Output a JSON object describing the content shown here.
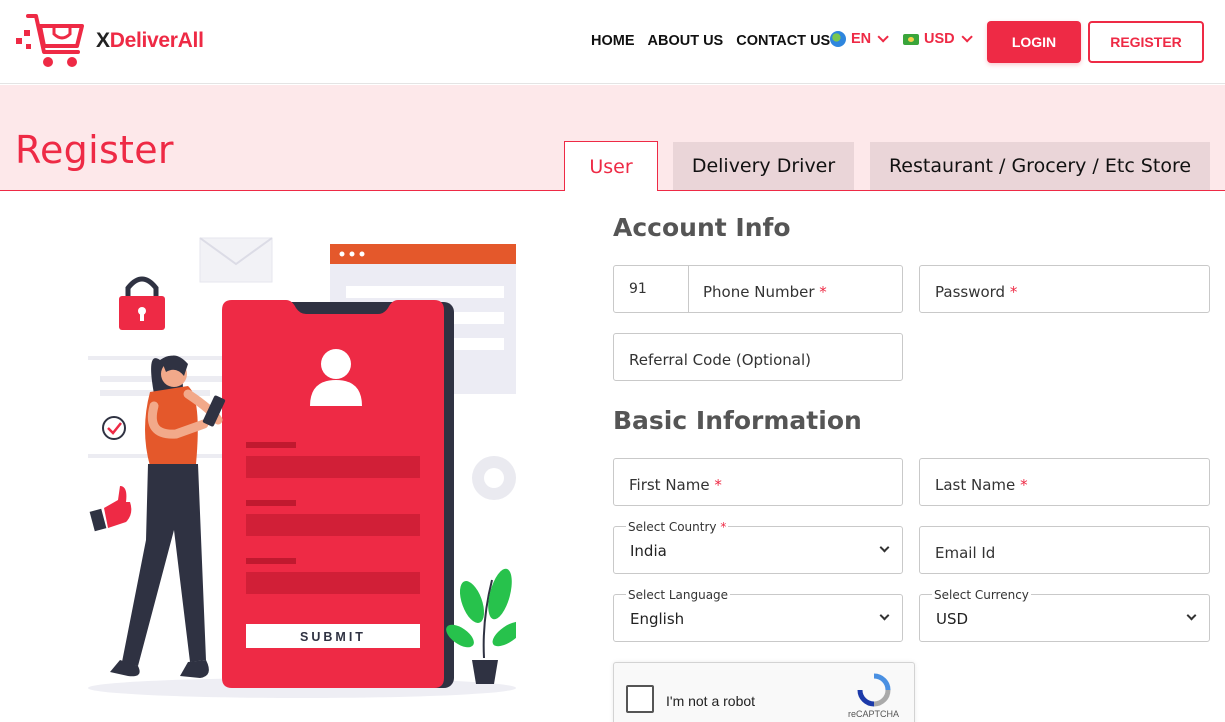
{
  "brand": {
    "name_prefix": "X",
    "name_rest": "DeliverAll",
    "accent": "#ee2a45"
  },
  "nav": {
    "items": [
      {
        "label": "HOME"
      },
      {
        "label": "ABOUT US"
      },
      {
        "label": "CONTACT US"
      }
    ],
    "language": {
      "icon": "globe-icon",
      "label": "EN"
    },
    "currency": {
      "icon": "flag-icon",
      "label": "USD"
    },
    "login_label": "LOGIN",
    "register_label": "REGISTER"
  },
  "page": {
    "title": "Register",
    "tabs": [
      {
        "label": "User",
        "active": true
      },
      {
        "label": "Delivery Driver",
        "active": false
      },
      {
        "label": "Restaurant / Grocery / Etc Store",
        "active": false
      }
    ]
  },
  "illustration": {
    "submit_label": "SUBMIT"
  },
  "form": {
    "account_title": "Account Info",
    "phone_code": "91",
    "phone_placeholder": "Phone Number",
    "password_placeholder": "Password",
    "referral_placeholder": "Referral Code (Optional)",
    "basic_title": "Basic Information",
    "first_name_placeholder": "First Name",
    "last_name_placeholder": "Last Name",
    "country": {
      "label": "Select Country",
      "value": "India"
    },
    "email_placeholder": "Email Id",
    "language": {
      "label": "Select Language",
      "value": "English"
    },
    "currency": {
      "label": "Select Currency",
      "value": "USD"
    },
    "required_mark": "*"
  },
  "captcha": {
    "label": "I'm not a robot",
    "brand": "reCAPTCHA"
  }
}
